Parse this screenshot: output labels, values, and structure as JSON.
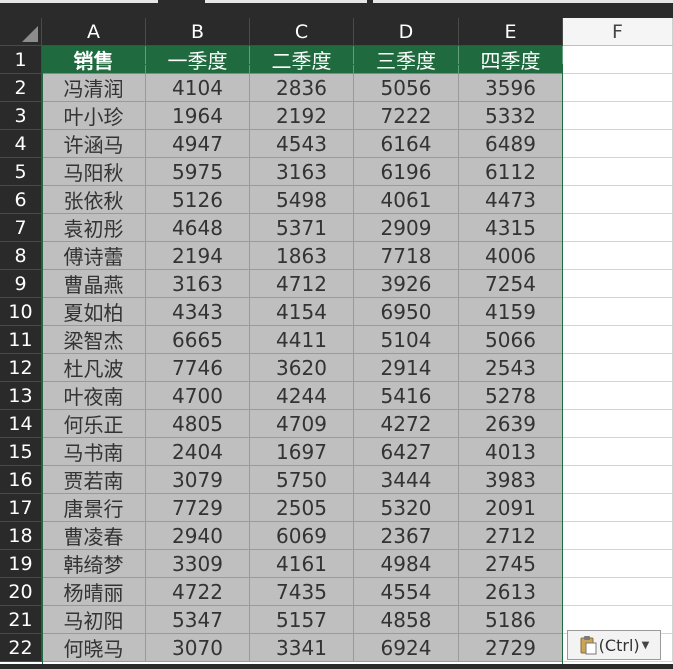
{
  "columns": [
    "A",
    "B",
    "C",
    "D",
    "E",
    "F"
  ],
  "row_numbers": [
    "1",
    "2",
    "3",
    "4",
    "5",
    "6",
    "7",
    "8",
    "9",
    "10",
    "11",
    "12",
    "13",
    "14",
    "15",
    "16",
    "17",
    "18",
    "19",
    "20",
    "21",
    "22"
  ],
  "table": {
    "headers": [
      "销售",
      "一季度",
      "二季度",
      "三季度",
      "四季度"
    ],
    "rows": [
      [
        "冯清润",
        "4104",
        "2836",
        "5056",
        "3596"
      ],
      [
        "叶小珍",
        "1964",
        "2192",
        "7222",
        "5332"
      ],
      [
        "许涵马",
        "4947",
        "4543",
        "6164",
        "6489"
      ],
      [
        "马阳秋",
        "5975",
        "3163",
        "6196",
        "6112"
      ],
      [
        "张依秋",
        "5126",
        "5498",
        "4061",
        "4473"
      ],
      [
        "袁初彤",
        "4648",
        "5371",
        "2909",
        "4315"
      ],
      [
        "傅诗蕾",
        "2194",
        "1863",
        "7718",
        "4006"
      ],
      [
        "曹晶燕",
        "3163",
        "4712",
        "3926",
        "7254"
      ],
      [
        "夏如柏",
        "4343",
        "4154",
        "6950",
        "4159"
      ],
      [
        "梁智杰",
        "6665",
        "4411",
        "5104",
        "5066"
      ],
      [
        "杜凡波",
        "7746",
        "3620",
        "2914",
        "2543"
      ],
      [
        "叶夜南",
        "4700",
        "4244",
        "5416",
        "5278"
      ],
      [
        "何乐正",
        "4805",
        "4709",
        "4272",
        "2639"
      ],
      [
        "马书南",
        "2404",
        "1697",
        "6427",
        "4013"
      ],
      [
        "贾若南",
        "3079",
        "5750",
        "3444",
        "3983"
      ],
      [
        "唐景行",
        "7729",
        "2505",
        "5320",
        "2091"
      ],
      [
        "曹凌春",
        "2940",
        "6069",
        "2367",
        "2712"
      ],
      [
        "韩绮梦",
        "3309",
        "4161",
        "4984",
        "2745"
      ],
      [
        "杨晴丽",
        "4722",
        "7435",
        "4554",
        "2613"
      ],
      [
        "马初阳",
        "5347",
        "5157",
        "4858",
        "5186"
      ],
      [
        "何晓马",
        "3070",
        "3341",
        "6924",
        "2729"
      ]
    ]
  },
  "paste_options": {
    "label": "(Ctrl)",
    "icon": "clipboard-icon"
  },
  "colors": {
    "header_green": "#1f6b3f",
    "data_gray": "#bfbfbf",
    "ui_dark": "#2a2a2a"
  }
}
